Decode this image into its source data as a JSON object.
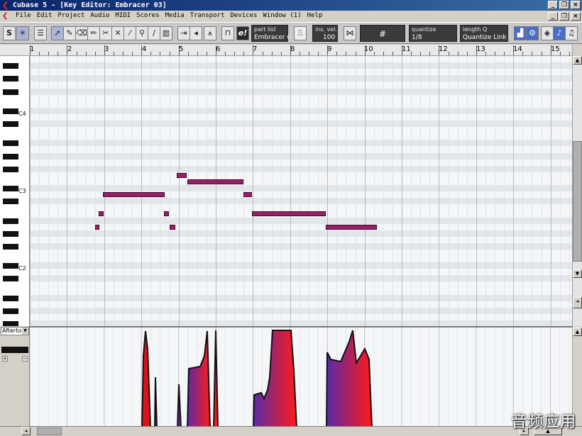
{
  "window": {
    "title": "Cubase 5 - [Key Editor: Embracer 03]",
    "app_icon": "cubase-logo-icon"
  },
  "menu": {
    "items": [
      "File",
      "Edit",
      "Project",
      "Audio",
      "MIDI",
      "Scores",
      "Media",
      "Transport",
      "Devices",
      "Window (1)",
      "Help"
    ]
  },
  "toolbar": {
    "solo_label": "S",
    "part_list_label": "part list",
    "part_list_value": "Embracer (-",
    "ins_vel_label": "ins. vel.",
    "ins_vel_value": "100",
    "quantize_label": "quantize",
    "quantize_value": "1/8",
    "length_q_label": "length Q",
    "length_q_value": "Quantize Link",
    "grid_symbol": "#",
    "e_label": "e!"
  },
  "ruler": {
    "bars": [
      "1",
      "2",
      "3",
      "4",
      "5",
      "6",
      "7",
      "8",
      "9",
      "10",
      "11",
      "12",
      "13",
      "14",
      "15"
    ]
  },
  "keyboard": {
    "octave_labels": [
      "C4",
      "C3",
      "C2"
    ]
  },
  "notes": [
    {
      "bar": 2.75,
      "len": 0.13,
      "row": 26
    },
    {
      "bar": 2.85,
      "len": 0.13,
      "row": 24
    },
    {
      "bar": 2.97,
      "len": 1.65,
      "row": 21
    },
    {
      "bar": 4.6,
      "len": 0.15,
      "row": 24
    },
    {
      "bar": 4.75,
      "len": 0.17,
      "row": 26
    },
    {
      "bar": 4.95,
      "len": 0.27,
      "row": 18
    },
    {
      "bar": 5.23,
      "len": 1.52,
      "row": 19
    },
    {
      "bar": 6.75,
      "len": 0.22,
      "row": 21
    },
    {
      "bar": 6.98,
      "len": 1.98,
      "row": 24
    },
    {
      "bar": 8.95,
      "len": 1.38,
      "row": 26
    }
  ],
  "controller": {
    "selected": "Aftertouch",
    "selected_display": "Afterto"
  },
  "colors": {
    "note_fill": "#9a1f6a",
    "controller_red": "#ff1a1a",
    "controller_purple": "#5a2aa8",
    "title_gradient_start": "#0a246a"
  },
  "watermark": "音频应用"
}
